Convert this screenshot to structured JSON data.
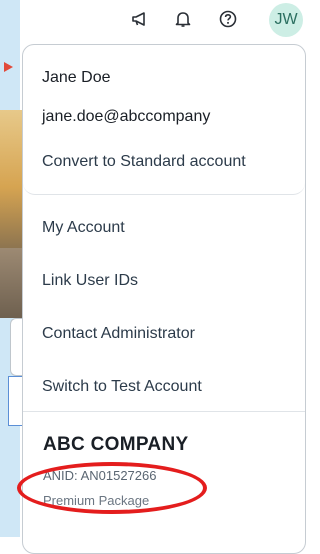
{
  "header": {
    "icons": [
      "announcement-icon",
      "bell-icon",
      "help-icon"
    ],
    "avatar_initials": "JW"
  },
  "user": {
    "name": "Jane Doe",
    "email": "jane.doe@abccompany",
    "convert_label": "Convert to Standard account"
  },
  "menu_items": [
    {
      "label": "My Account"
    },
    {
      "label": "Link User IDs"
    },
    {
      "label": "Contact Administrator"
    },
    {
      "label": "Switch to Test Account"
    }
  ],
  "company": {
    "name": "ABC COMPANY",
    "anid": "ANID: AN01527266",
    "package": "Premium Package"
  },
  "colors": {
    "avatar_bg": "#cdeee5",
    "annotation": "#e41d1d"
  }
}
